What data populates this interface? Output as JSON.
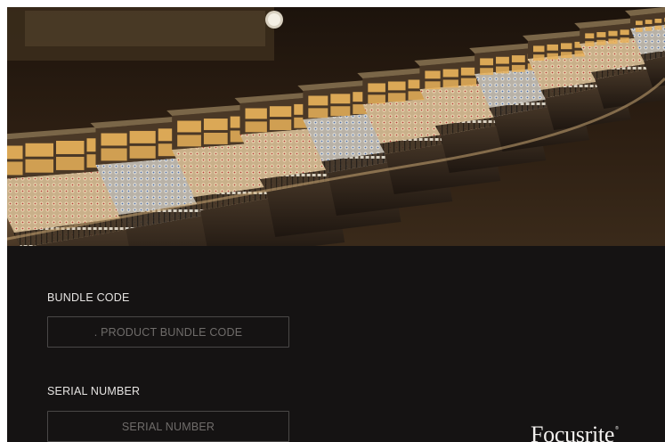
{
  "hero": {
    "image": "mixing-console-photo"
  },
  "form": {
    "bundle": {
      "label": "BUNDLE CODE",
      "placeholder": ". PRODUCT BUNDLE CODE",
      "value": ""
    },
    "serial": {
      "label": "SERIAL NUMBER",
      "placeholder": "SERIAL NUMBER",
      "value": ""
    }
  },
  "brand": {
    "name": "Focusrite",
    "mark": "®"
  },
  "colors": {
    "background": "#151313",
    "input_border": "#4a4847",
    "label_text": "#e6e4e2",
    "placeholder_text": "#6f6c6a",
    "console_amber": "#e7b25a"
  }
}
